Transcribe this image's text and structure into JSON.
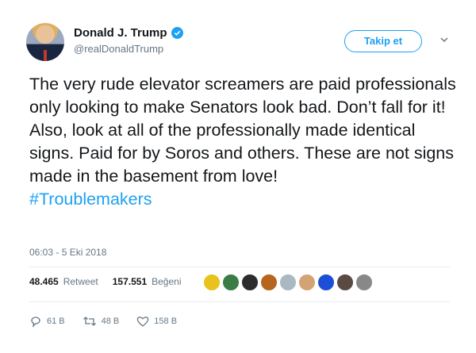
{
  "author": {
    "name": "Donald J. Trump",
    "handle": "@realDonaldTrump"
  },
  "follow_button": "Takip et",
  "tweet": {
    "text": "The very rude elevator screamers are paid professionals only looking to make Senators look bad. Don’t fall for it! Also, look at all of the professionally made identical signs. Paid for by Soros and others. These are not signs made in the basement from love!",
    "hashtag": "#Troublemakers"
  },
  "timestamp": "06:03 - 5 Eki 2018",
  "stats": {
    "retweets_count": "48.465",
    "retweets_label": "Retweet",
    "likes_count": "157.551",
    "likes_label": "Beğeni"
  },
  "likers": [
    {
      "icon": "liker-avatar",
      "color": "#e8c21e"
    },
    {
      "icon": "liker-avatar",
      "color": "#3a7d44"
    },
    {
      "icon": "liker-avatar",
      "color": "#2c2c2c"
    },
    {
      "icon": "liker-avatar",
      "color": "#b5651d"
    },
    {
      "icon": "liker-avatar",
      "color": "#aab8c2"
    },
    {
      "icon": "liker-avatar",
      "color": "#d4a373"
    },
    {
      "icon": "liker-avatar",
      "color": "#1d4ed8"
    },
    {
      "icon": "liker-avatar",
      "color": "#5a4a42"
    },
    {
      "icon": "liker-avatar",
      "color": "#888888"
    }
  ],
  "actions": {
    "replies": "61 B",
    "retweets": "48 B",
    "likes": "158 B"
  },
  "colors": {
    "accent": "#1da1f2",
    "muted": "#657786",
    "text": "#14171a"
  }
}
